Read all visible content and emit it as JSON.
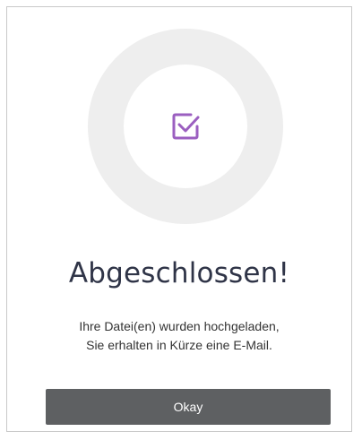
{
  "dialog": {
    "title": "Abgeschlossen!",
    "message_line1": "Ihre Datei(en) wurden hochgeladen,",
    "message_line2": "Sie erhalten in Kürze eine E-Mail.",
    "okay_label": "Okay",
    "icon": "checkbox-checked-icon"
  },
  "colors": {
    "accent": "#9b5fc0",
    "ring": "#eeeeee",
    "title": "#2f3447",
    "button": "#5e6062"
  }
}
